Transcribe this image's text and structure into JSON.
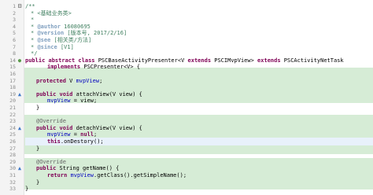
{
  "editor": {
    "lines": [
      {
        "n": "1",
        "marker": "fold",
        "indent": 0,
        "cur": false,
        "t": [
          [
            "/**",
            "cm"
          ]
        ]
      },
      {
        "n": "2",
        "marker": "",
        "indent": 1,
        "cur": false,
        "t": [
          [
            "* <基础业务类>",
            "cm"
          ]
        ]
      },
      {
        "n": "3",
        "marker": "",
        "indent": 1,
        "cur": false,
        "t": [
          [
            "*",
            "cm"
          ]
        ]
      },
      {
        "n": "4",
        "marker": "",
        "indent": 1,
        "cur": false,
        "t": [
          [
            "* ",
            "cm"
          ],
          [
            "@author",
            "tag"
          ],
          [
            " 16080695",
            "cm"
          ]
        ]
      },
      {
        "n": "5",
        "marker": "",
        "indent": 1,
        "cur": false,
        "t": [
          [
            "* ",
            "cm"
          ],
          [
            "@version",
            "tag"
          ],
          [
            " [版本号, 2017/2/16]",
            "cm"
          ]
        ]
      },
      {
        "n": "6",
        "marker": "",
        "indent": 1,
        "cur": false,
        "t": [
          [
            "* ",
            "cm"
          ],
          [
            "@see",
            "tag"
          ],
          [
            " [相关类/方法]",
            "cm"
          ]
        ]
      },
      {
        "n": "7",
        "marker": "",
        "indent": 1,
        "cur": false,
        "t": [
          [
            "* ",
            "cm"
          ],
          [
            "@since",
            "tag"
          ],
          [
            " [V1]",
            "cm"
          ]
        ]
      },
      {
        "n": "8",
        "marker": "",
        "indent": 1,
        "cur": false,
        "t": [
          [
            "*/",
            "cm"
          ]
        ]
      },
      {
        "n": "14",
        "marker": "dot",
        "indent": 0,
        "cur": false,
        "t": [
          [
            "public abstract class ",
            "kw"
          ],
          [
            "PSCBaseActivityPresenter",
            "typ"
          ],
          [
            "<V ",
            "txt"
          ],
          [
            "extends ",
            "kw"
          ],
          [
            "PSCIMvpView",
            "typ"
          ],
          [
            "> ",
            "txt"
          ],
          [
            "extends ",
            "kw"
          ],
          [
            "PSCActivityNetTask",
            "typ"
          ]
        ]
      },
      {
        "n": "15",
        "marker": "",
        "indent": 4,
        "cur": false,
        "t": [
          [
            "implements ",
            "kw"
          ],
          [
            "PSCPresenter",
            "typ"
          ],
          [
            "<V> {",
            "txt"
          ]
        ]
      },
      {
        "n": "16",
        "marker": "",
        "indent": 0,
        "cur": false,
        "t": [
          [
            "",
            "txt"
          ]
        ]
      },
      {
        "n": "17",
        "marker": "",
        "indent": 2,
        "cur": false,
        "t": [
          [
            "protected ",
            "kw"
          ],
          [
            "V ",
            "txt"
          ],
          [
            "mvpView",
            "fld"
          ],
          [
            ";",
            "txt"
          ]
        ]
      },
      {
        "n": "18",
        "marker": "",
        "indent": 0,
        "cur": false,
        "t": [
          [
            "",
            "txt"
          ]
        ]
      },
      {
        "n": "19",
        "marker": "override",
        "indent": 2,
        "cur": false,
        "t": [
          [
            "public void ",
            "kw"
          ],
          [
            "attachView(V view) {",
            "mth"
          ]
        ]
      },
      {
        "n": "20",
        "marker": "",
        "indent": 4,
        "cur": false,
        "t": [
          [
            "mvpView",
            "fld"
          ],
          [
            " = view;",
            "txt"
          ]
        ]
      },
      {
        "n": "21",
        "marker": "",
        "indent": 2,
        "cur": false,
        "t": [
          [
            "}",
            "txt"
          ]
        ]
      },
      {
        "n": "22",
        "marker": "",
        "indent": 0,
        "cur": false,
        "t": [
          [
            "",
            "txt"
          ]
        ]
      },
      {
        "n": "23",
        "marker": "",
        "indent": 2,
        "cur": false,
        "t": [
          [
            "@Override",
            "ann"
          ]
        ]
      },
      {
        "n": "24",
        "marker": "override",
        "indent": 2,
        "cur": false,
        "t": [
          [
            "public void ",
            "kw"
          ],
          [
            "detachView(V view) {",
            "mth"
          ]
        ]
      },
      {
        "n": "25",
        "marker": "",
        "indent": 4,
        "cur": false,
        "t": [
          [
            "mvpView",
            "fld"
          ],
          [
            " = ",
            "txt"
          ],
          [
            "null",
            "kw"
          ],
          [
            ";",
            "txt"
          ]
        ]
      },
      {
        "n": "26",
        "marker": "",
        "indent": 4,
        "cur": true,
        "t": [
          [
            "this",
            "kw"
          ],
          [
            ".onDestory();",
            "txt"
          ]
        ]
      },
      {
        "n": "27",
        "marker": "",
        "indent": 2,
        "cur": false,
        "t": [
          [
            "}",
            "txt"
          ]
        ]
      },
      {
        "n": "28",
        "marker": "",
        "indent": 0,
        "cur": false,
        "t": [
          [
            "",
            "txt"
          ]
        ]
      },
      {
        "n": "29",
        "marker": "",
        "indent": 2,
        "cur": false,
        "t": [
          [
            "@Override",
            "ann"
          ]
        ]
      },
      {
        "n": "30",
        "marker": "override",
        "indent": 2,
        "cur": false,
        "t": [
          [
            "public ",
            "kw"
          ],
          [
            "String getName() {",
            "mth"
          ]
        ]
      },
      {
        "n": "31",
        "marker": "",
        "indent": 4,
        "cur": false,
        "t": [
          [
            "return ",
            "kw"
          ],
          [
            "mvpView",
            "fld"
          ],
          [
            ".getClass().getSimpleName();",
            "txt"
          ]
        ]
      },
      {
        "n": "32",
        "marker": "",
        "indent": 2,
        "cur": false,
        "t": [
          [
            "}",
            "txt"
          ]
        ]
      },
      {
        "n": "33",
        "marker": "",
        "indent": 0,
        "cur": false,
        "t": [
          [
            "}",
            "txt"
          ]
        ]
      }
    ]
  }
}
